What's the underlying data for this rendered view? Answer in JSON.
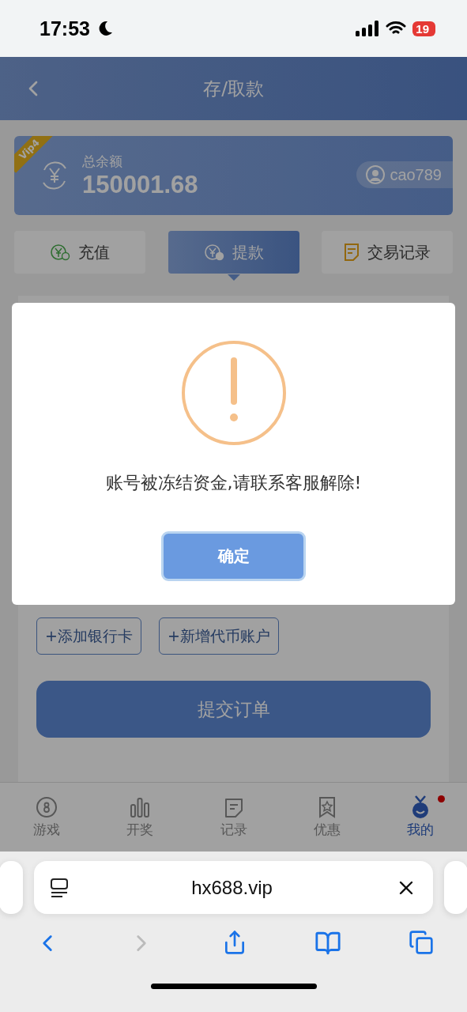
{
  "status_bar": {
    "time": "17:53",
    "battery": "19"
  },
  "header": {
    "title": "存/取款"
  },
  "account": {
    "vip": "Vip4",
    "label": "总余额",
    "balance": "150001.68",
    "username": "cao789"
  },
  "tabs": [
    {
      "label": "充值",
      "kind": "deposit",
      "selected": false
    },
    {
      "label": "提款",
      "kind": "withdraw",
      "selected": true
    },
    {
      "label": "交易记录",
      "kind": "records",
      "selected": false
    }
  ],
  "actions": [
    "+添加银行卡",
    "+新增代币账户"
  ],
  "submit": "提交订单",
  "dialog": {
    "message": "账号被冻结资金,请联系客服解除!",
    "confirm": "确定"
  },
  "bottom_nav": [
    {
      "label": "游戏",
      "kind": "games",
      "selected": false,
      "dot": false
    },
    {
      "label": "开奖",
      "kind": "draws",
      "selected": false,
      "dot": false
    },
    {
      "label": "记录",
      "kind": "records",
      "selected": false,
      "dot": false
    },
    {
      "label": "优惠",
      "kind": "offers",
      "selected": false,
      "dot": false
    },
    {
      "label": "我的",
      "kind": "me",
      "selected": true,
      "dot": true
    }
  ],
  "browser": {
    "url": "hx688.vip"
  }
}
